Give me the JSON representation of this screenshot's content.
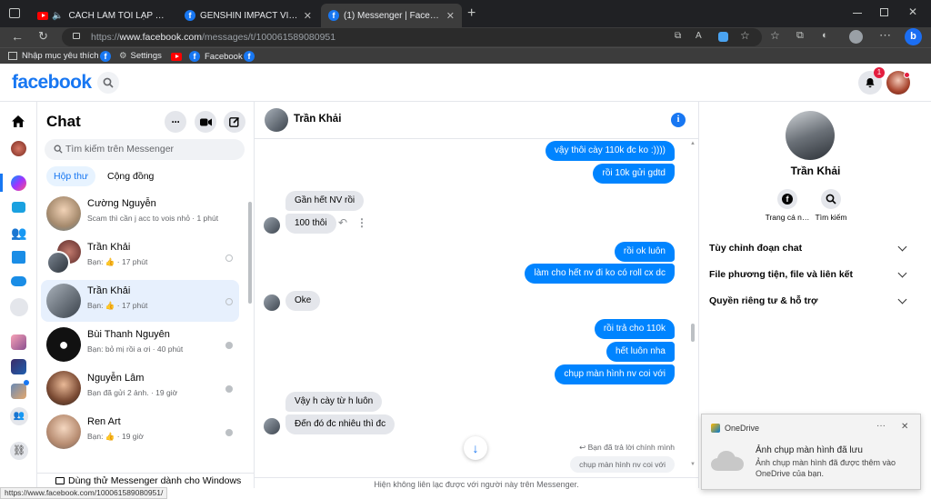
{
  "browser": {
    "tabs": [
      {
        "title": "CÁCH LÀM TÔI LẠP BÁT - M…",
        "favicon": "youtube-icon",
        "muted": true
      },
      {
        "title": "GENSHIN IMPACT VIỆT NAM TRA…",
        "favicon": "facebook-icon"
      },
      {
        "title": "(1) Messenger | Facebook",
        "favicon": "facebook-icon",
        "active": true
      }
    ],
    "url_prefix": "https://",
    "url_domain": "www.facebook.com",
    "url_path": "/messages/t/100061589080951",
    "bookmarks": [
      {
        "label": "Nhập mục yêu thích",
        "icon": "import-icon"
      },
      {
        "label": "",
        "icon": "facebook-icon"
      },
      {
        "label": "Settings",
        "icon": "gear-icon"
      },
      {
        "label": "",
        "icon": "youtube-icon"
      },
      {
        "label": "Facebook",
        "icon": "facebook-icon"
      },
      {
        "label": "",
        "icon": "facebook-icon"
      }
    ],
    "status_url": "https://www.facebook.com/100061589080951/"
  },
  "fb": {
    "logo": "facebook",
    "notification_count": "1"
  },
  "chat": {
    "title": "Chat",
    "search_placeholder": "Tìm kiếm trên Messenger",
    "tabs": [
      "Hộp thư",
      "Cộng đồng"
    ],
    "conversations": [
      {
        "name": "Cường Nguyễn",
        "preview": "Scam thì cần j acc to vois nhỏ · 1 phút"
      },
      {
        "name": "Trần Khải",
        "preview": "Bạn: 👍 · 17 phút"
      },
      {
        "name": "Trần Khải",
        "preview": "Bạn: 👍 · 17 phút",
        "selected": true
      },
      {
        "name": "Bùi Thanh Nguyên",
        "preview": "Bạn: bỏ mị rồi a ơi · 40 phút"
      },
      {
        "name": "Nguyễn Lâm",
        "preview": "Bạn đã gửi 2 ảnh. · 19 giờ"
      },
      {
        "name": "Ren Art",
        "preview": "Bạn: 👍 · 19 giờ"
      }
    ],
    "footer": "Dùng thử Messenger dành cho Windows"
  },
  "thread": {
    "contact_name": "Trần Khải",
    "messages": [
      {
        "dir": "out",
        "text": "vậy thôi cày 110k đc ko :))))"
      },
      {
        "dir": "out",
        "text": "rồi 10k gửi gdtd"
      },
      {
        "dir": "in",
        "text": "Gần hết NV rồi"
      },
      {
        "dir": "in",
        "text": "100 thôi"
      },
      {
        "dir": "out",
        "text": "rồi ok luôn"
      },
      {
        "dir": "out",
        "text": "làm cho hết nv đi ko có roll cx dc"
      },
      {
        "dir": "in",
        "text": "Oke"
      },
      {
        "dir": "out",
        "text": "rồi trả cho 110k"
      },
      {
        "dir": "out",
        "text": "hết luôn nha"
      },
      {
        "dir": "out",
        "text": "chụp màn hình nv coi với"
      },
      {
        "dir": "in",
        "text": "Vậy h cày từ h luôn"
      },
      {
        "dir": "in",
        "text": "Đến đó đc nhiêu thì đc"
      }
    ],
    "reply_label": "Bạn đã trả lời chính mình",
    "reply_quote": "chụp màn hình nv coi với",
    "footer_notice": "Hiện không liên lạc được với người này trên Messenger."
  },
  "profile": {
    "name": "Trần Khải",
    "actions": [
      {
        "label": "Trang cá n…",
        "icon": "facebook-icon"
      },
      {
        "label": "Tìm kiếm",
        "icon": "search-icon"
      }
    ],
    "sections": [
      "Tùy chỉnh đoạn chat",
      "File phương tiện, file và liên kết",
      "Quyền riêng tư & hỗ trợ"
    ]
  },
  "onedrive": {
    "app": "OneDrive",
    "title": "Ảnh chụp màn hình đã lưu",
    "body": "Ảnh chụp màn hình đã được thêm vào OneDrive của bạn."
  }
}
